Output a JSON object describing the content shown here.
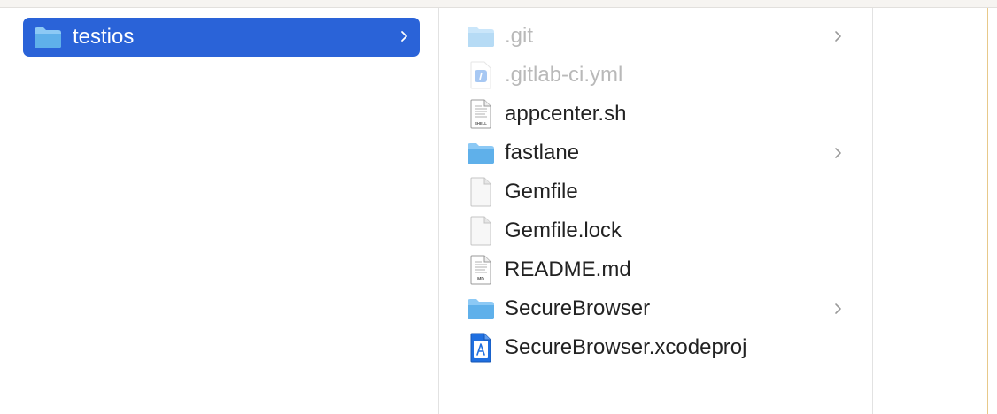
{
  "left_column": {
    "selected_folder": {
      "name": "testios",
      "icon": "folder-icon",
      "has_children": true
    }
  },
  "middle_column": {
    "items": [
      {
        "name": ".git",
        "icon": "folder-icon",
        "dimmed": true,
        "has_children": true
      },
      {
        "name": ".gitlab-ci.yml",
        "icon": "yml-file-icon",
        "dimmed": true,
        "has_children": false
      },
      {
        "name": "appcenter.sh",
        "icon": "shell-script-icon",
        "badge": "SHELL",
        "dimmed": false,
        "has_children": false
      },
      {
        "name": "fastlane",
        "icon": "folder-icon",
        "dimmed": false,
        "has_children": true
      },
      {
        "name": "Gemfile",
        "icon": "document-icon",
        "dimmed": false,
        "has_children": false
      },
      {
        "name": "Gemfile.lock",
        "icon": "document-icon",
        "dimmed": false,
        "has_children": false
      },
      {
        "name": "README.md",
        "icon": "markdown-file-icon",
        "badge": "MD",
        "dimmed": false,
        "has_children": false
      },
      {
        "name": "SecureBrowser",
        "icon": "folder-icon",
        "dimmed": false,
        "has_children": true
      },
      {
        "name": "SecureBrowser.xcodeproj",
        "icon": "xcode-project-icon",
        "dimmed": false,
        "has_children": false
      }
    ]
  },
  "colors": {
    "selection": "#2a63d8",
    "folder": "#5fb0ea",
    "text": "#222222",
    "dimmed_text": "#b9b9b9"
  }
}
